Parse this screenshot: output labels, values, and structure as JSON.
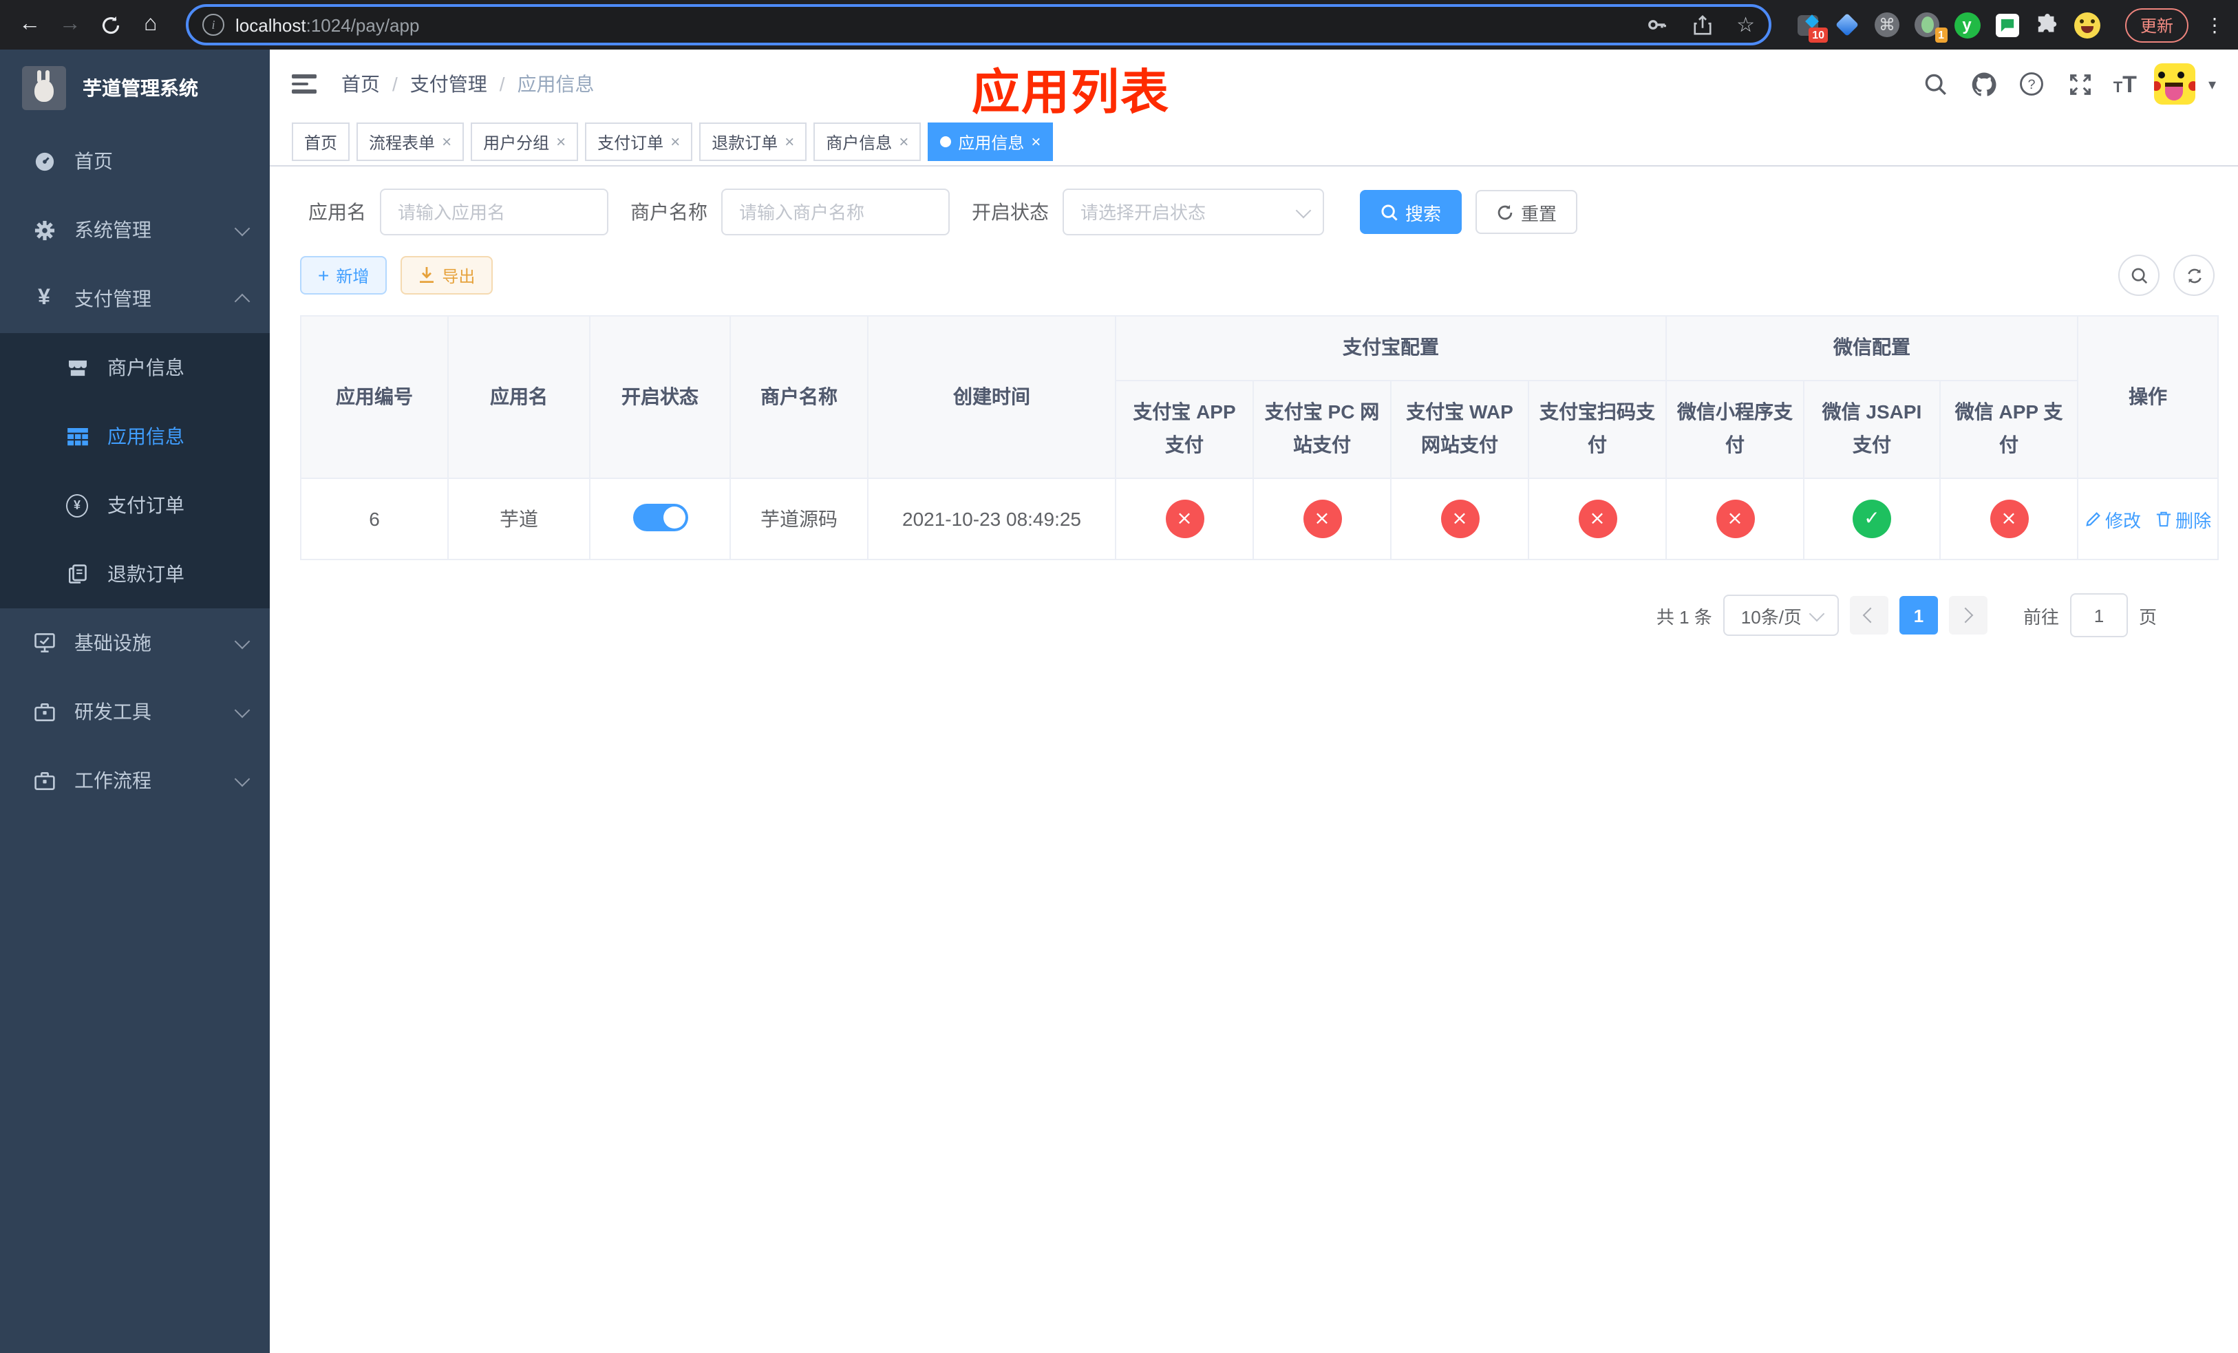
{
  "colors": {
    "accent": "#409eff",
    "success_green": "#1ec05f",
    "danger_red": "#f75353",
    "warning_yellow": "#e6a23c",
    "sidebar_bg": "#304156",
    "sidebar_submenu_bg": "#1f2d3d",
    "annotation_red": "#fe2b00",
    "active_tab_blue": "#409eff"
  },
  "icons": {
    "back": "←",
    "forward": "→",
    "home": "⌂",
    "info": "i",
    "star": "☆",
    "command": "⌘",
    "more": "⋮",
    "close": "×",
    "caret_down": "▾",
    "yen": "¥",
    "plus": "+",
    "check": "✓",
    "cross": "×",
    "letter_y": "y",
    "font_size_large": "T",
    "font_size_small": "T"
  },
  "browser": {
    "url_host": "localhost",
    "url_rest": ":1024/pay/app",
    "ext_badge_1": "10",
    "ext_badge_2": "1",
    "update_label": "更新"
  },
  "sidebar": {
    "title": "芋道管理系统",
    "items": [
      {
        "label": "首页"
      },
      {
        "label": "系统管理"
      },
      {
        "label": "支付管理"
      },
      {
        "label": "商户信息"
      },
      {
        "label": "应用信息"
      },
      {
        "label": "支付订单"
      },
      {
        "label": "退款订单"
      },
      {
        "label": "基础设施"
      },
      {
        "label": "研发工具"
      },
      {
        "label": "工作流程"
      }
    ]
  },
  "navbar": {
    "breadcrumb": [
      {
        "label": "首页"
      },
      {
        "label": "支付管理"
      },
      {
        "label": "应用信息"
      }
    ],
    "breadcrumb_separator": "/",
    "annotation": "应用列表"
  },
  "tabs": [
    {
      "label": "首页"
    },
    {
      "label": "流程表单"
    },
    {
      "label": "用户分组"
    },
    {
      "label": "支付订单"
    },
    {
      "label": "退款订单"
    },
    {
      "label": "商户信息"
    },
    {
      "label": "应用信息"
    }
  ],
  "filters": {
    "app_name_label": "应用名",
    "app_name_placeholder": "请输入应用名",
    "merchant_label": "商户名称",
    "merchant_placeholder": "请输入商户名称",
    "status_label": "开启状态",
    "status_placeholder": "请选择开启状态",
    "search_label": "搜索",
    "reset_label": "重置"
  },
  "toolbar": {
    "add_label": "新增",
    "export_label": "导出"
  },
  "table": {
    "groups": {
      "alipay": "支付宝配置",
      "wechat": "微信配置"
    },
    "columns": {
      "id": "应用编号",
      "name": "应用名",
      "enabled": "开启状态",
      "merchant": "商户名称",
      "created": "创建时间",
      "alipay_app": "支付宝 APP 支付",
      "alipay_pc": "支付宝 PC 网站支付",
      "alipay_wap": "支付宝 WAP 网站支付",
      "alipay_qr": "支付宝扫码支付",
      "wx_mini": "微信小程序支付",
      "wx_jsapi": "微信 JSAPI 支付",
      "wx_app": "微信 APP 支付",
      "actions": "操作"
    },
    "row": {
      "id": "6",
      "name": "芋道",
      "enabled": true,
      "merchant": "芋道源码",
      "created": "2021-10-23 08:49:25",
      "statuses": [
        false,
        false,
        false,
        false,
        false,
        true,
        false
      ],
      "edit_label": "修改",
      "delete_label": "删除"
    }
  },
  "pagination": {
    "total": "共 1 条",
    "page_size": "10条/页",
    "page": "1",
    "goto_prefix": "前往",
    "goto_value": "1",
    "goto_suffix": "页"
  }
}
